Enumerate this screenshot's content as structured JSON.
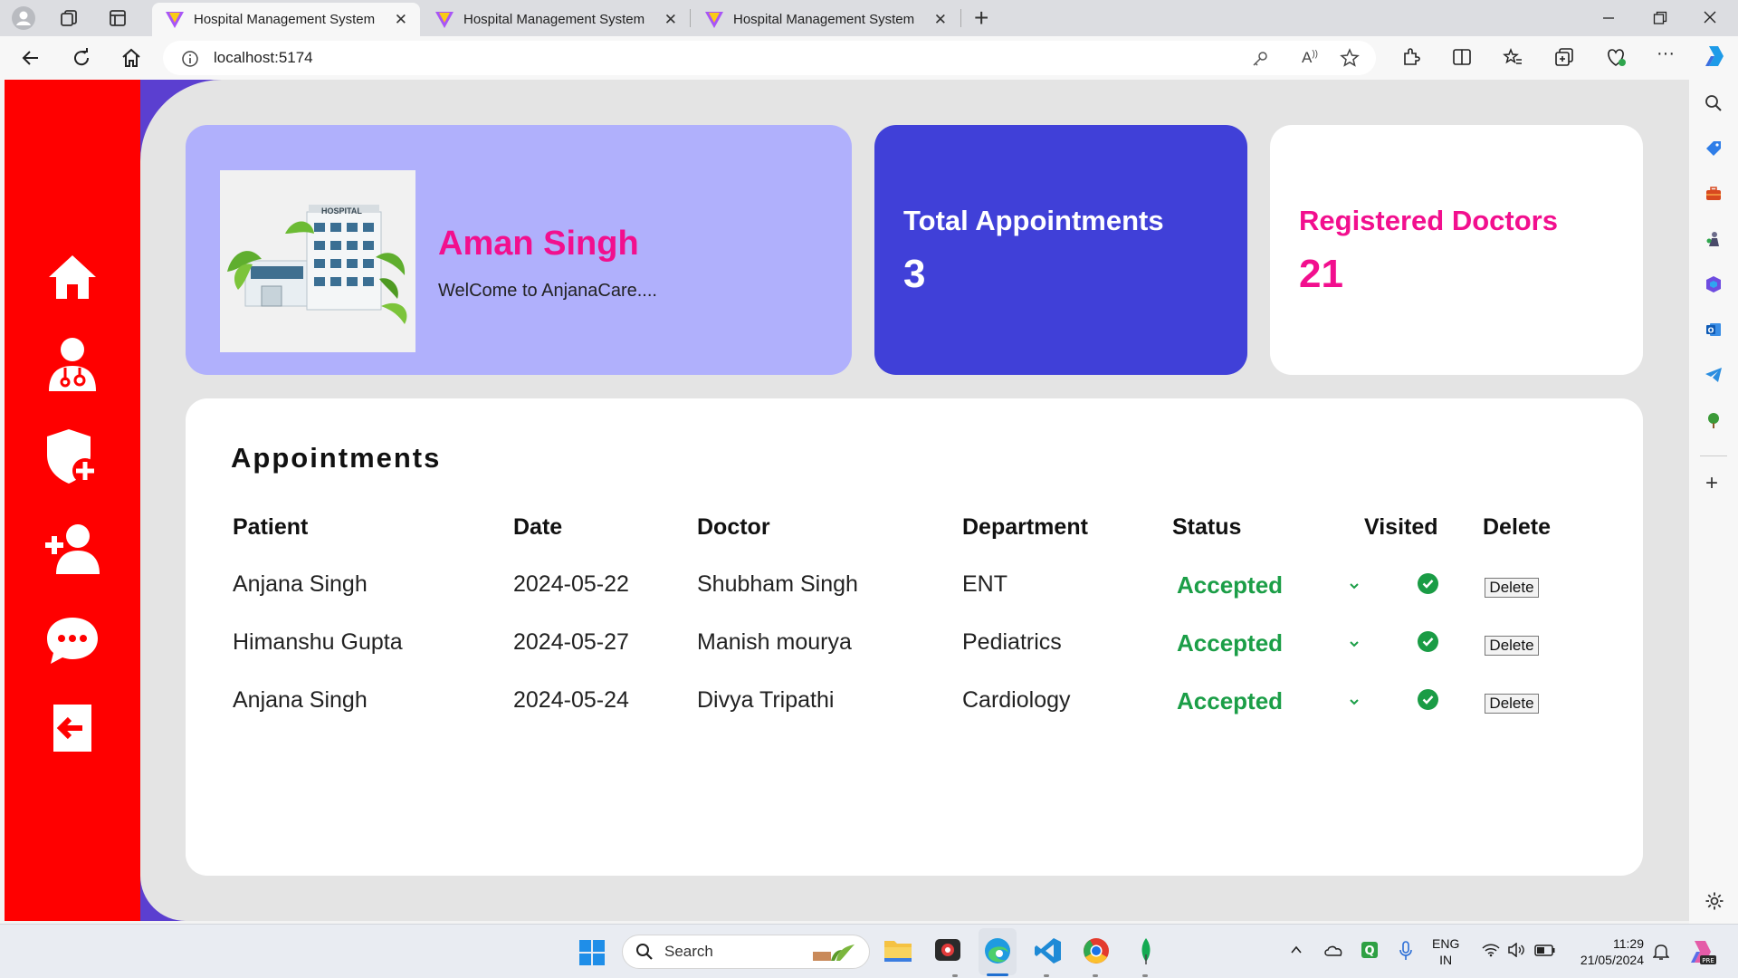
{
  "browser": {
    "tabs": [
      {
        "title": "Hospital Management System",
        "active": true
      },
      {
        "title": "Hospital Management System",
        "active": false
      },
      {
        "title": "Hospital Management System",
        "active": false
      }
    ],
    "new_tab_label": "+",
    "url": "localhost:5174"
  },
  "sidebar": {
    "items": [
      "home-icon",
      "doctor-icon",
      "shield-plus-icon",
      "add-user-icon",
      "chat-icon",
      "logout-icon"
    ]
  },
  "profile": {
    "image_label": "HOSPITAL",
    "name": "Aman Singh",
    "welcome": "WelCome to AnjanaCare...."
  },
  "stats": {
    "total_label": "Total Appointments",
    "total_value": "3",
    "doctors_label": "Registered Doctors",
    "doctors_value": "21"
  },
  "appointments": {
    "title": "Appointments",
    "headers": [
      "Patient",
      "Date",
      "Doctor",
      "Department",
      "Status",
      "Visited",
      "Delete"
    ],
    "rows": [
      {
        "patient": "Anjana Singh",
        "date": "2024-05-22",
        "doctor": "Shubham Singh",
        "department": "ENT",
        "status": "Accepted",
        "visited": true,
        "delete": "Delete"
      },
      {
        "patient": "Himanshu Gupta",
        "date": "2024-05-27",
        "doctor": "Manish mourya",
        "department": "Pediatrics",
        "status": "Accepted",
        "visited": true,
        "delete": "Delete"
      },
      {
        "patient": "Anjana Singh",
        "date": "2024-05-24",
        "doctor": "Divya Tripathi",
        "department": "Cardiology",
        "status": "Accepted",
        "visited": true,
        "delete": "Delete"
      }
    ]
  },
  "taskbar": {
    "search_label": "Search",
    "lang": "ENG",
    "region": "IN",
    "time": "11:29",
    "date": "21/05/2024"
  },
  "colors": {
    "sidebar": "#ff0000",
    "accent_pink": "#f20f8e",
    "stat_blue": "#4040d8",
    "welcome_card": "#b0b0fc",
    "accepted_green": "#1b9e47"
  }
}
